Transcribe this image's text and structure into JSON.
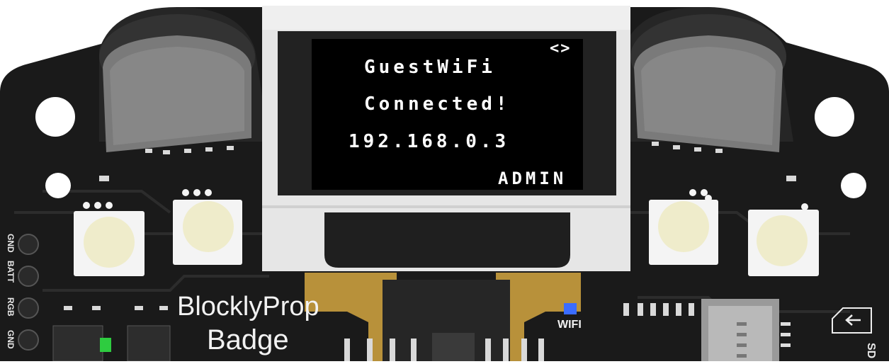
{
  "display": {
    "nav_symbol": "<>",
    "line1": "GuestWiFi",
    "line2": "Connected!",
    "line3": "192.168.0.3",
    "footer": "ADMIN"
  },
  "silkscreen": {
    "title_line1": "BlocklyProp",
    "title_line2": "Badge",
    "wifi_label": "WIFI",
    "pins": [
      "GND",
      "BATT",
      "RGB",
      "GND"
    ],
    "sd_label": "SD"
  },
  "colors": {
    "board": "#1a1a1a",
    "bezel": "#e6e6e6",
    "screen": "#000000",
    "led_lens": "#efeccb",
    "flex_cable": "#b8913a",
    "status_led": "#2ecc40",
    "wifi_led": "#3a6cff"
  }
}
